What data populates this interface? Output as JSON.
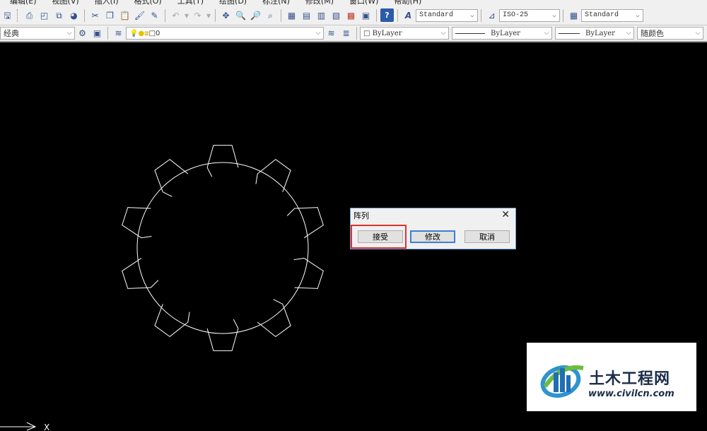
{
  "menubar": {
    "items": [
      "编辑(E)",
      "视图(V)",
      "插入(I)",
      "格式(O)",
      "工具(T)",
      "绘图(D)",
      "标注(N)",
      "修改(M)",
      "窗口(W)",
      "帮助(H)"
    ]
  },
  "toolbar1": {
    "text_style": "Standard",
    "dim_style": "ISO-25",
    "table_style": "Standard"
  },
  "toolbar2": {
    "workspace": "经典",
    "layer": "0",
    "color": "ByLayer",
    "linetype": "ByLayer",
    "lineweight": "ByLayer",
    "plot_style": "随颜色"
  },
  "dialog": {
    "title": "阵列",
    "close": "✕",
    "accept": "接受",
    "modify": "修改",
    "cancel": "取消"
  },
  "ucs": {
    "x_label": "X"
  },
  "watermark": {
    "brand": "土木工程网",
    "url": "www.civilcn.com"
  },
  "colors": {
    "canvas": "#000000",
    "geometry": "#ffffff",
    "highlight": "#e0322f",
    "dialog_border": "#6c9ed8"
  }
}
